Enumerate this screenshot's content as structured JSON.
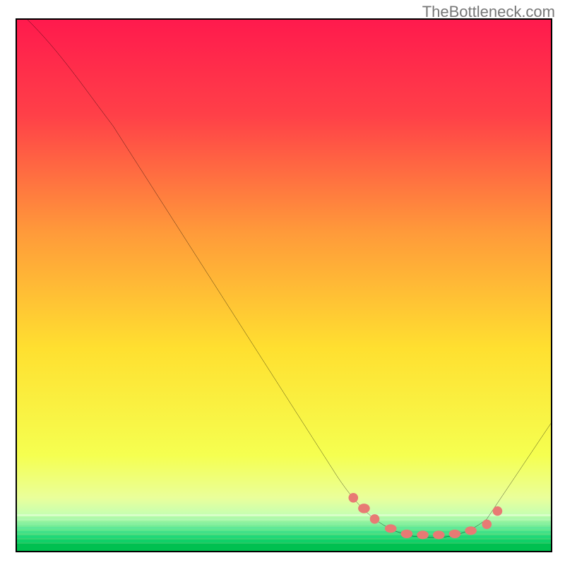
{
  "watermark": "TheBottleneck.com",
  "chart_data": {
    "type": "line",
    "title": "",
    "xlabel": "",
    "ylabel": "",
    "xlim": [
      0,
      100
    ],
    "ylim": [
      0,
      100
    ],
    "gradient_colors": {
      "top": "#ff1a4d",
      "upper_mid": "#ff8040",
      "mid": "#ffe030",
      "lower_mid": "#eaff60",
      "bottom_band": "#20e070",
      "bottom": "#00c050"
    },
    "curve": [
      {
        "x": 2,
        "y": 100
      },
      {
        "x": 10,
        "y": 92
      },
      {
        "x": 18,
        "y": 80
      },
      {
        "x": 60,
        "y": 14
      },
      {
        "x": 66,
        "y": 6
      },
      {
        "x": 72,
        "y": 3
      },
      {
        "x": 80,
        "y": 2.5
      },
      {
        "x": 86,
        "y": 4
      },
      {
        "x": 92,
        "y": 10
      },
      {
        "x": 100,
        "y": 24
      }
    ],
    "markers": [
      {
        "x": 63,
        "y": 10
      },
      {
        "x": 65,
        "y": 8
      },
      {
        "x": 67,
        "y": 6
      },
      {
        "x": 70,
        "y": 4.2
      },
      {
        "x": 73,
        "y": 3.2
      },
      {
        "x": 76,
        "y": 3.0
      },
      {
        "x": 79,
        "y": 3.0
      },
      {
        "x": 82,
        "y": 3.2
      },
      {
        "x": 85,
        "y": 3.8
      },
      {
        "x": 88,
        "y": 5.0
      },
      {
        "x": 90,
        "y": 7.5
      }
    ],
    "marker_color": "#e87a74",
    "curve_color": "#000000"
  }
}
